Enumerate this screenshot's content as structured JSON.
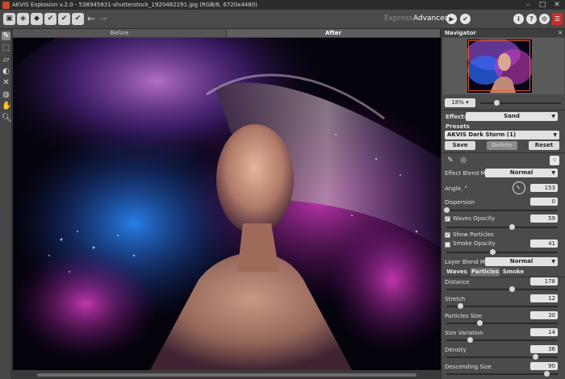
{
  "window": {
    "title": "AKVIS Explosion v.2.0 - 538945831-shutterstock_1920482291.jpg (RGB/8, 6720x4480)",
    "controls": [
      "–",
      "□",
      "✕"
    ]
  },
  "toolbar": {
    "left_buttons": [
      {
        "name": "open-file-icon",
        "glyph": "▣"
      },
      {
        "name": "batch-icon",
        "glyph": "◈"
      },
      {
        "name": "save-file-icon",
        "glyph": "◆"
      },
      {
        "name": "print-icon",
        "glyph": "✔"
      },
      {
        "name": "share-icon",
        "glyph": "✔"
      },
      {
        "name": "export-icon",
        "glyph": "✔"
      },
      {
        "name": "preferences-icon",
        "glyph": "✎"
      }
    ],
    "undo_glyph": "←",
    "redo_glyph": "→",
    "mode_express": "Express",
    "mode_advanced": "Advanced",
    "run_glyph": "▶",
    "apply_glyph": "✔",
    "about_glyph": "i",
    "help_glyph": "?",
    "settings_glyph": "⚙",
    "brand_glyph": "☰"
  },
  "tools": [
    {
      "name": "selection-brush-tool-icon",
      "glyph": "✎",
      "active": true
    },
    {
      "name": "lasso-tool-icon",
      "glyph": "⬚",
      "active": false
    },
    {
      "name": "eraser-tool-icon",
      "glyph": "▱",
      "active": false
    },
    {
      "name": "bucket-tool-icon",
      "glyph": "◐",
      "active": false
    },
    {
      "name": "direction-tool-icon",
      "glyph": "✕",
      "active": false
    },
    {
      "name": "eyedropper-tool-icon",
      "glyph": "◍",
      "active": false
    },
    {
      "name": "hand-tool-icon",
      "glyph": "✋",
      "active": false
    },
    {
      "name": "zoom-tool-icon",
      "glyph": "🔍︎",
      "active": false
    }
  ],
  "view_tabs": {
    "before": "Before",
    "after": "After"
  },
  "navigator": {
    "title": "Navigator",
    "close_glyph": "✕",
    "zoom": "18%",
    "zoom_level": 0.2
  },
  "effect": {
    "label": "Effect:",
    "value": "Sand"
  },
  "presets": {
    "label": "Presets",
    "value": "AKVIS Dark Storm (1)",
    "save": "Save",
    "delete": "Delete",
    "reset": "Reset"
  },
  "effect_blend": {
    "label": "Effect Blend Mode",
    "value": "Normal"
  },
  "params_top": [
    {
      "key": "angle",
      "label": "Angle, °",
      "value": "153"
    },
    {
      "key": "dispersion",
      "label": "Dispersion",
      "value": "0",
      "pos": 0.0
    },
    {
      "key": "waves_opacity",
      "label": "Waves Opacity",
      "value": "59",
      "pos": 0.59,
      "checkbox": true,
      "checked": true
    },
    {
      "key": "show_particles",
      "label": "Show Particles",
      "checkbox_only": true,
      "checked": true
    },
    {
      "key": "smoke_opacity",
      "label": "Smoke Opacity",
      "value": "41",
      "pos": 0.41,
      "checkbox": true,
      "checked": false
    }
  ],
  "layer_blend": {
    "label": "Layer Blend Mode",
    "value": "Normal"
  },
  "sub_tabs": {
    "waves": "Waves",
    "particles": "Particles",
    "smoke": "Smoke"
  },
  "particles": [
    {
      "label": "Distance",
      "value": "178",
      "pos": 0.59
    },
    {
      "label": "Stretch",
      "value": "12",
      "pos": 0.12
    },
    {
      "label": "Particles Size",
      "value": "30",
      "pos": 0.3
    },
    {
      "label": "Size Variation",
      "value": "14",
      "pos": 0.21
    },
    {
      "label": "Density",
      "value": "36",
      "pos": 0.8
    },
    {
      "label": "Descending Size",
      "value": "90",
      "pos": 0.9
    }
  ]
}
